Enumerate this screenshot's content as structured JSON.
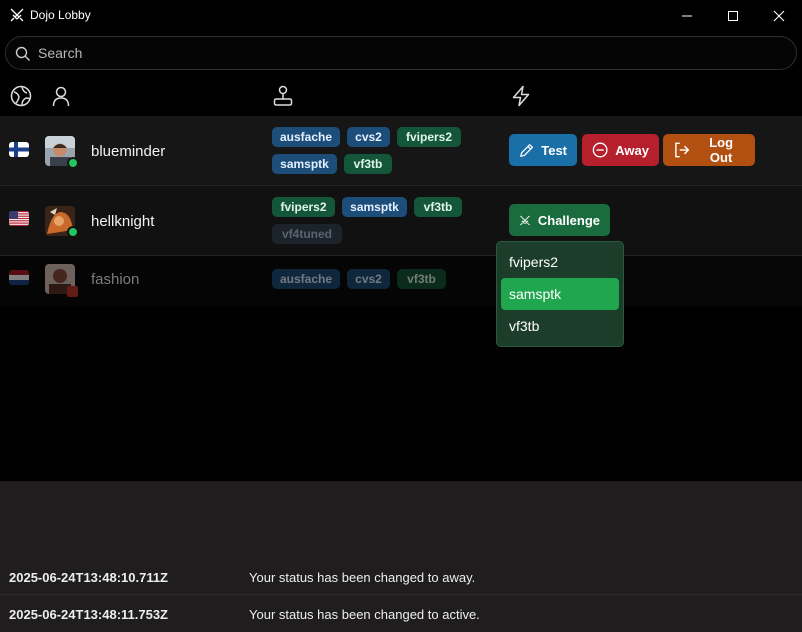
{
  "window": {
    "title": "Dojo Lobby"
  },
  "search": {
    "placeholder": "Search",
    "value": ""
  },
  "header_icons": [
    "globe-icon",
    "user-icon",
    "joystick-icon",
    "lightning-icon"
  ],
  "players": [
    {
      "flag": "finland",
      "name": "blueminder",
      "status": "online",
      "games": [
        {
          "label": "ausfache",
          "color": "blue"
        },
        {
          "label": "cvs2",
          "color": "blue"
        },
        {
          "label": "fvipers2",
          "color": "green"
        },
        {
          "label": "samsptk",
          "color": "blue"
        },
        {
          "label": "vf3tb",
          "color": "green"
        }
      ],
      "actions": [
        {
          "label": "Test",
          "icon": "pen-icon"
        },
        {
          "label": "Away",
          "icon": "minus-circle-icon"
        },
        {
          "label": "Log Out",
          "icon": "logout-icon"
        }
      ]
    },
    {
      "flag": "usa",
      "name": "hellknight",
      "status": "online",
      "games": [
        {
          "label": "fvipers2",
          "color": "green"
        },
        {
          "label": "samsptk",
          "color": "blue"
        },
        {
          "label": "vf3tb",
          "color": "green"
        },
        {
          "label": "vf4tuned",
          "color": "dim"
        }
      ],
      "actions": [
        {
          "label": "Challenge",
          "icon": "swords-icon"
        }
      ]
    },
    {
      "flag": "netherlands",
      "name": "fashion",
      "status": "away",
      "games": [
        {
          "label": "ausfache",
          "color": "blue"
        },
        {
          "label": "cvs2",
          "color": "blue"
        },
        {
          "label": "vf3tb",
          "color": "green"
        }
      ],
      "actions": []
    }
  ],
  "challenge_menu": {
    "items": [
      "fvipers2",
      "samsptk",
      "vf3tb"
    ],
    "selected": "samsptk"
  },
  "log": [
    {
      "time": "2025-06-24T13:48:10.711Z",
      "message": "Your status has been changed to away."
    },
    {
      "time": "2025-06-24T13:48:11.753Z",
      "message": "Your status has been changed to active."
    }
  ],
  "colors": {
    "tag_blue": "#1d4e7a",
    "tag_green": "#14563a",
    "test_button": "#1a6fa8",
    "away_button": "#b5202c",
    "logout_button": "#b25012",
    "challenge_button": "#1a6b3e",
    "menu_selected": "#1fa64f",
    "online_dot": "#22c55e"
  }
}
